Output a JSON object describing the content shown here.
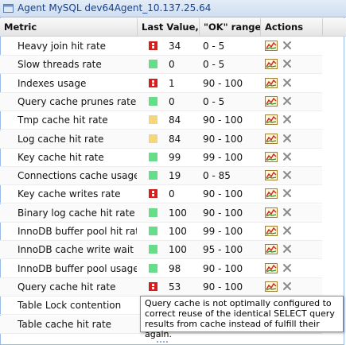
{
  "window": {
    "title": "Agent MySQL dev64Agent_10.137.25.64"
  },
  "columns": {
    "metric": "Metric",
    "value": "Last Value,%",
    "range": "\"OK\" range,%",
    "actions": "Actions"
  },
  "rows": [
    {
      "metric": "Heavy join hit rate",
      "status": "crit",
      "value": "34",
      "range": "0 - 5"
    },
    {
      "metric": "Slow threads rate",
      "status": "ok",
      "value": "0",
      "range": "0 - 5"
    },
    {
      "metric": "Indexes usage",
      "status": "crit",
      "value": "1",
      "range": "90 - 100"
    },
    {
      "metric": "Query cache prunes rate",
      "status": "ok",
      "value": "0",
      "range": "0 - 5"
    },
    {
      "metric": "Tmp cache hit rate",
      "status": "warn",
      "value": "84",
      "range": "90 - 100"
    },
    {
      "metric": "Log cache hit rate",
      "status": "warn",
      "value": "84",
      "range": "90 - 100"
    },
    {
      "metric": "Key cache hit rate",
      "status": "ok",
      "value": "99",
      "range": "99 - 100"
    },
    {
      "metric": "Connections cache usage",
      "status": "ok",
      "value": "19",
      "range": "0 - 85"
    },
    {
      "metric": "Key cache writes rate",
      "status": "crit",
      "value": "0",
      "range": "90 - 100"
    },
    {
      "metric": "Binary log cache hit rate",
      "status": "ok",
      "value": "100",
      "range": "90 - 100"
    },
    {
      "metric": "InnoDB buffer pool hit rate",
      "status": "ok",
      "value": "100",
      "range": "99 - 100"
    },
    {
      "metric": "InnoDB cache write wait ra",
      "status": "ok",
      "value": "100",
      "range": "95 - 100"
    },
    {
      "metric": "InnoDB buffer pool usage",
      "status": "ok",
      "value": "98",
      "range": "90 - 100"
    },
    {
      "metric": "Query cache hit rate",
      "status": "crit",
      "value": "53",
      "range": "90 - 100"
    },
    {
      "metric": "Table Lock contention",
      "status": "",
      "value": "",
      "range": ""
    },
    {
      "metric": "Table cache hit rate",
      "status": "",
      "value": "",
      "range": ""
    }
  ],
  "tooltip": {
    "text": "Query cache is not optimally configured to correct reuse of the identical SELECT query results from cache instead of fulfill their again."
  },
  "colors": {
    "ok": "#66dd88",
    "warn": "#f4d77a",
    "crit": "#d61e1e",
    "title_text": "#15428b"
  }
}
